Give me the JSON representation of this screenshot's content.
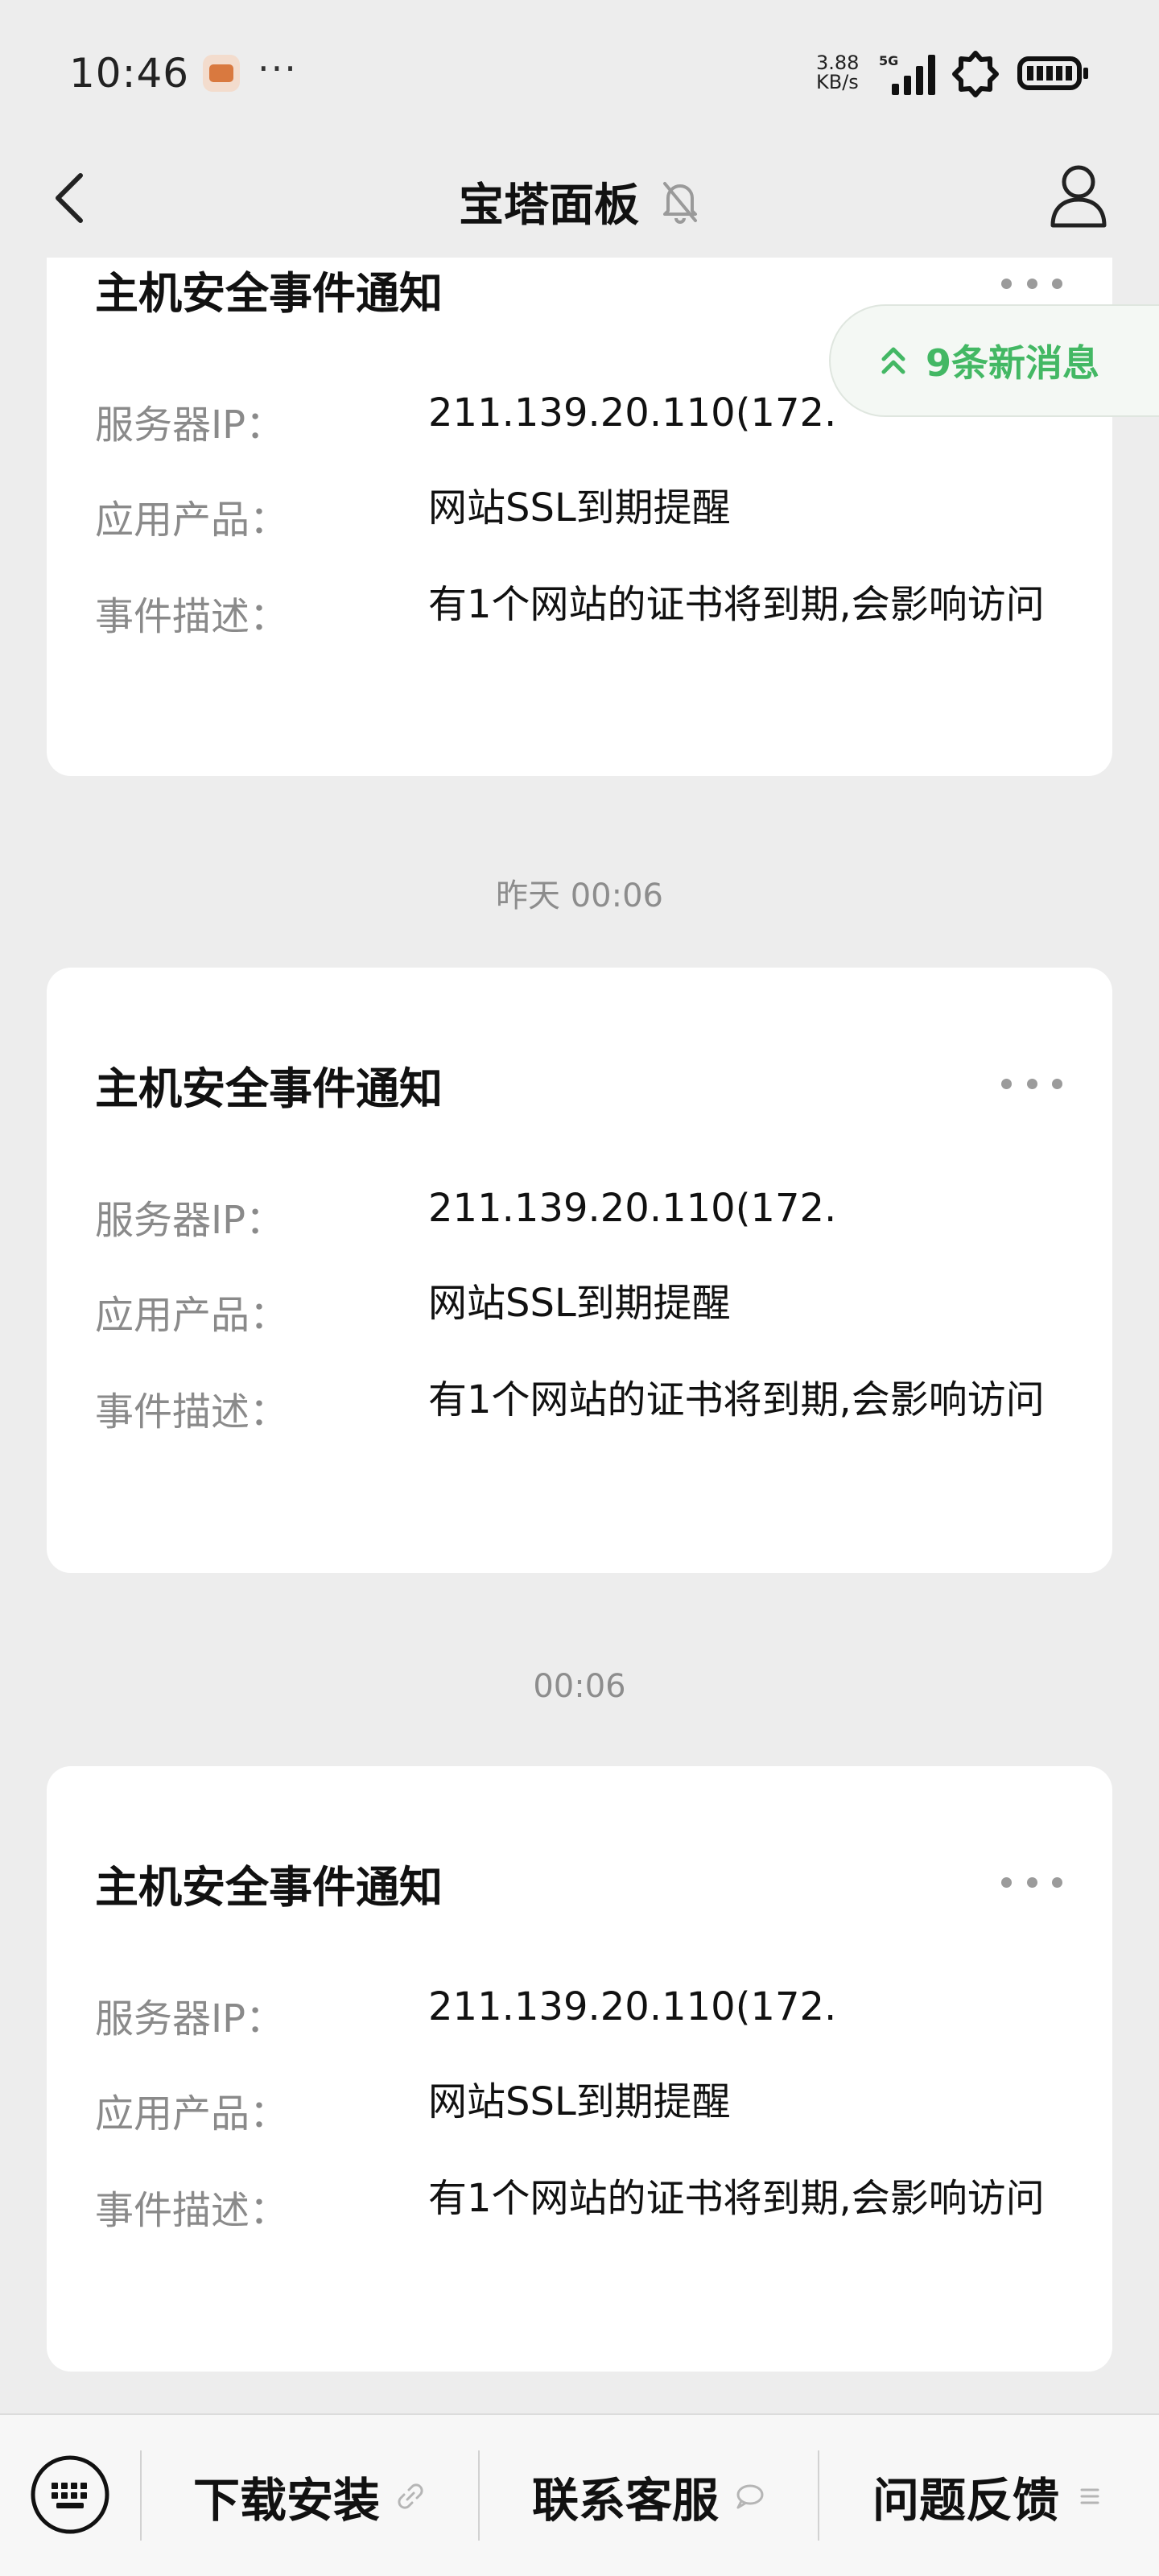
{
  "status_bar": {
    "time": "10:46",
    "more": "···",
    "net_speed_value": "3.88",
    "net_speed_unit": "KB/s",
    "network_type": "5G",
    "icons": [
      "app-notification-icon",
      "signal-icon",
      "settings-icon",
      "battery-icon"
    ]
  },
  "nav": {
    "title": "宝塔面板",
    "icons": [
      "back-arrow-icon",
      "mute-bell-icon",
      "profile-icon"
    ]
  },
  "new_messages": {
    "label": "9条新消息",
    "color": "#43b864"
  },
  "timestamps": [
    "昨天 00:06",
    "00:06"
  ],
  "cards": [
    {
      "title": "主机安全事件通知",
      "fields": [
        {
          "label": "服务器IP：",
          "value": "211.139.20.110(172."
        },
        {
          "label": "应用产品：",
          "value": "网站SSL到期提醒"
        },
        {
          "label": "事件描述：",
          "value": "有1个网站的证书将到期,会影响访问"
        }
      ]
    },
    {
      "title": "主机安全事件通知",
      "fields": [
        {
          "label": "服务器IP：",
          "value": "211.139.20.110(172."
        },
        {
          "label": "应用产品：",
          "value": "网站SSL到期提醒"
        },
        {
          "label": "事件描述：",
          "value": "有1个网站的证书将到期,会影响访问"
        }
      ]
    },
    {
      "title": "主机安全事件通知",
      "fields": [
        {
          "label": "服务器IP：",
          "value": "211.139.20.110(172."
        },
        {
          "label": "应用产品：",
          "value": "网站SSL到期提醒"
        },
        {
          "label": "事件描述：",
          "value": "有1个网站的证书将到期,会影响访问"
        }
      ]
    }
  ],
  "bottom_menu": [
    {
      "label": "下载安装",
      "icon": "link-icon"
    },
    {
      "label": "联系客服",
      "icon": "chat-bubble-icon"
    },
    {
      "label": "问题反馈",
      "icon": "menu-lines-icon"
    }
  ],
  "colors": {
    "background": "#ededed",
    "card": "#ffffff",
    "label_gray": "#8a8a8a",
    "accent_green": "#43b864"
  }
}
